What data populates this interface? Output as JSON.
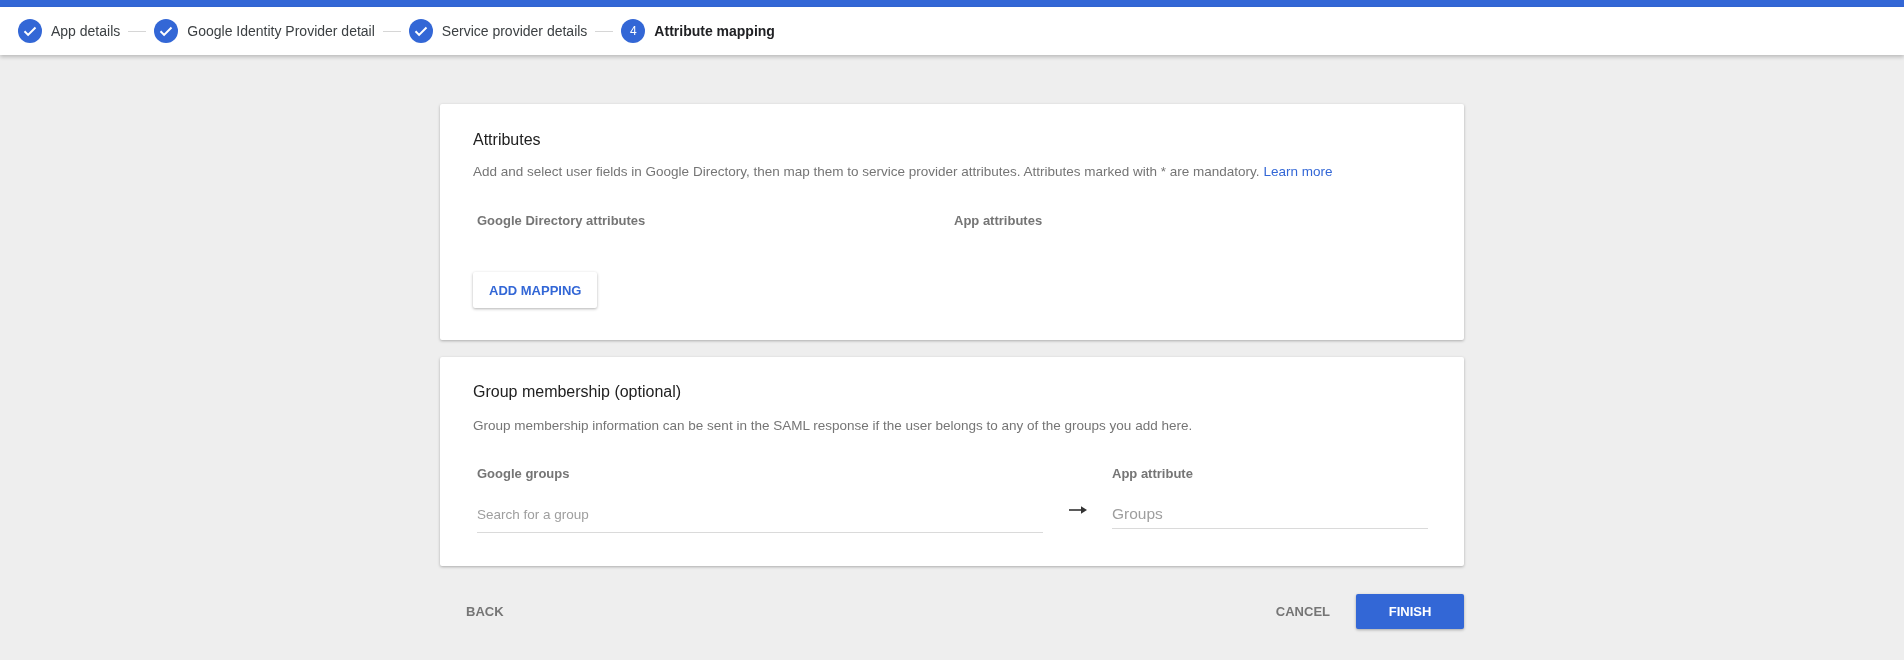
{
  "stepper": {
    "steps": [
      {
        "label": "App details",
        "completed": true,
        "selected": false
      },
      {
        "label": "Google Identity Provider detail",
        "completed": true,
        "selected": false
      },
      {
        "label": "Service provider details",
        "completed": true,
        "selected": false
      },
      {
        "label": "Attribute mapping",
        "number": "4",
        "completed": false,
        "selected": true
      }
    ]
  },
  "attributes_card": {
    "title": "Attributes",
    "description": "Add and select user fields in Google Directory, then map them to service provider attributes. Attributes marked with * are mandatory.",
    "link": "Learn more",
    "columns": [
      "Google Directory attributes",
      "App attributes"
    ],
    "add_button": "ADD MAPPING"
  },
  "group_membership_card": {
    "title": "Group membership (optional)",
    "description": "Group membership information can be sent in the SAML response if the user belongs to any of the groups you add here.",
    "google_groups": {
      "label": "Google groups",
      "placeholder": "Search for a group"
    },
    "app_attribute": {
      "label": "App attribute",
      "placeholder": "Groups"
    }
  },
  "footer": {
    "back_button": "BACK",
    "cancel_button": "CANCEL",
    "finish_button": "FINISH"
  }
}
